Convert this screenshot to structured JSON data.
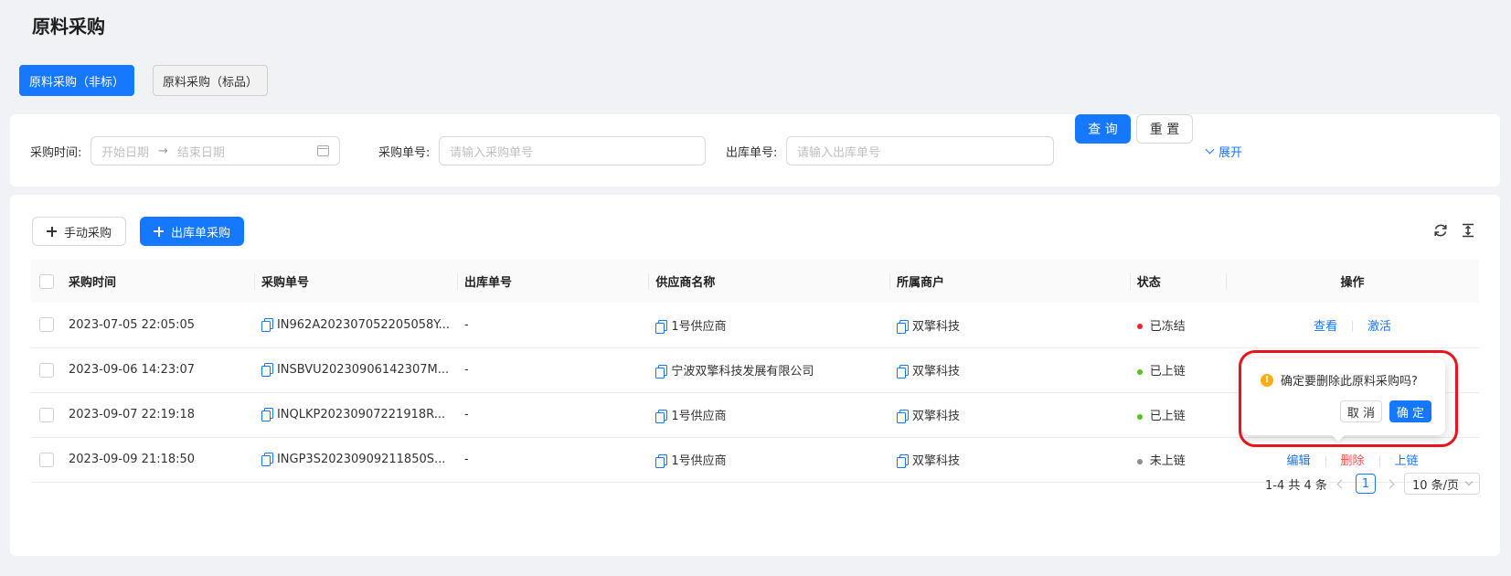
{
  "page": {
    "title": "原料采购"
  },
  "tabs": [
    {
      "label": "原料采购（非标）",
      "active": true
    },
    {
      "label": "原料采购（标品）",
      "active": false
    }
  ],
  "search": {
    "time_label": "采购时间:",
    "start_placeholder": "开始日期",
    "end_placeholder": "结束日期",
    "range_arrow": "→",
    "order_label": "采购单号:",
    "order_placeholder": "请输入采购单号",
    "outbound_label": "出库单号:",
    "outbound_placeholder": "请输入出库单号",
    "query_label": "查 询",
    "reset_label": "重 置",
    "expand_label": "展开"
  },
  "toolbar": {
    "manual_label": "手动采购",
    "outbound_label": "出库单采购",
    "refresh_icon": "refresh-icon",
    "density_icon": "column-height-icon"
  },
  "table": {
    "columns": [
      "采购时间",
      "采购单号",
      "出库单号",
      "供应商名称",
      "所属商户",
      "状态",
      "操作"
    ],
    "rows": [
      {
        "time": "2023-07-05 22:05:05",
        "order_no": "IN962A202307052205058Y...",
        "outbound_no": "-",
        "supplier": "1号供应商",
        "merchant": "双擎科技",
        "status": "已冻结",
        "status_color": "#f5222d",
        "actions": [
          {
            "label": "查看",
            "danger": false
          },
          {
            "label": "激活",
            "danger": false
          }
        ]
      },
      {
        "time": "2023-09-06 14:23:07",
        "order_no": "INSBVU20230906142307M...",
        "outbound_no": "-",
        "supplier": "宁波双擎科技发展有限公司",
        "merchant": "双擎科技",
        "status": "已上链",
        "status_color": "#52c41a",
        "actions": []
      },
      {
        "time": "2023-09-07 22:19:18",
        "order_no": "INQLKP20230907221918R...",
        "outbound_no": "-",
        "supplier": "1号供应商",
        "merchant": "双擎科技",
        "status": "已上链",
        "status_color": "#52c41a",
        "actions": []
      },
      {
        "time": "2023-09-09 21:18:50",
        "order_no": "INGP3S20230909211850S...",
        "outbound_no": "-",
        "supplier": "1号供应商",
        "merchant": "双擎科技",
        "status": "未上链",
        "status_color": "#8c8c8c",
        "actions": [
          {
            "label": "编辑",
            "danger": false
          },
          {
            "label": "删除",
            "danger": true
          },
          {
            "label": "上链",
            "danger": false
          }
        ]
      }
    ]
  },
  "pagination": {
    "summary": "1-4 共 4 条",
    "current": "1",
    "page_size": "10 条/页"
  },
  "popconfirm": {
    "message": "确定要删除此原料采购吗?",
    "cancel_label": "取 消",
    "ok_label": "确 定"
  },
  "colors": {
    "primary": "#1677ff",
    "danger": "#ff4d4f",
    "warning": "#faad14",
    "highlight_frame": "#e8141b"
  }
}
